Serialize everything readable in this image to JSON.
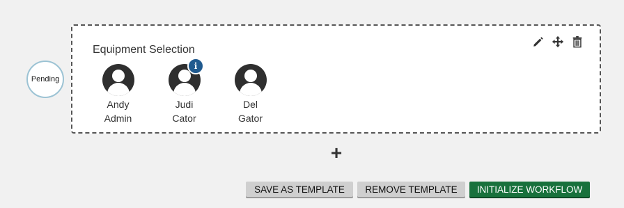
{
  "status": {
    "label": "Pending"
  },
  "step": {
    "title": "Equipment Selection",
    "assignees": [
      {
        "first": "Andy",
        "last": "Admin",
        "has_info": false
      },
      {
        "first": "Judi",
        "last": "Cator",
        "has_info": true,
        "info_glyph": "i"
      },
      {
        "first": "Del",
        "last": "Gator",
        "has_info": false
      }
    ],
    "tools": [
      "pencil-icon",
      "move-icon",
      "trash-icon"
    ]
  },
  "add_step": {
    "glyph": "+"
  },
  "buttons": {
    "save_template": "SAVE AS TEMPLATE",
    "remove_template": "REMOVE TEMPLATE",
    "initialize_workflow": "INITIALIZE WORKFLOW"
  },
  "colors": {
    "initialize_button": "#18713c",
    "gray_button": "#cfcfcf",
    "info_badge": "#205a8f",
    "status_border": "#9cc3d4"
  }
}
